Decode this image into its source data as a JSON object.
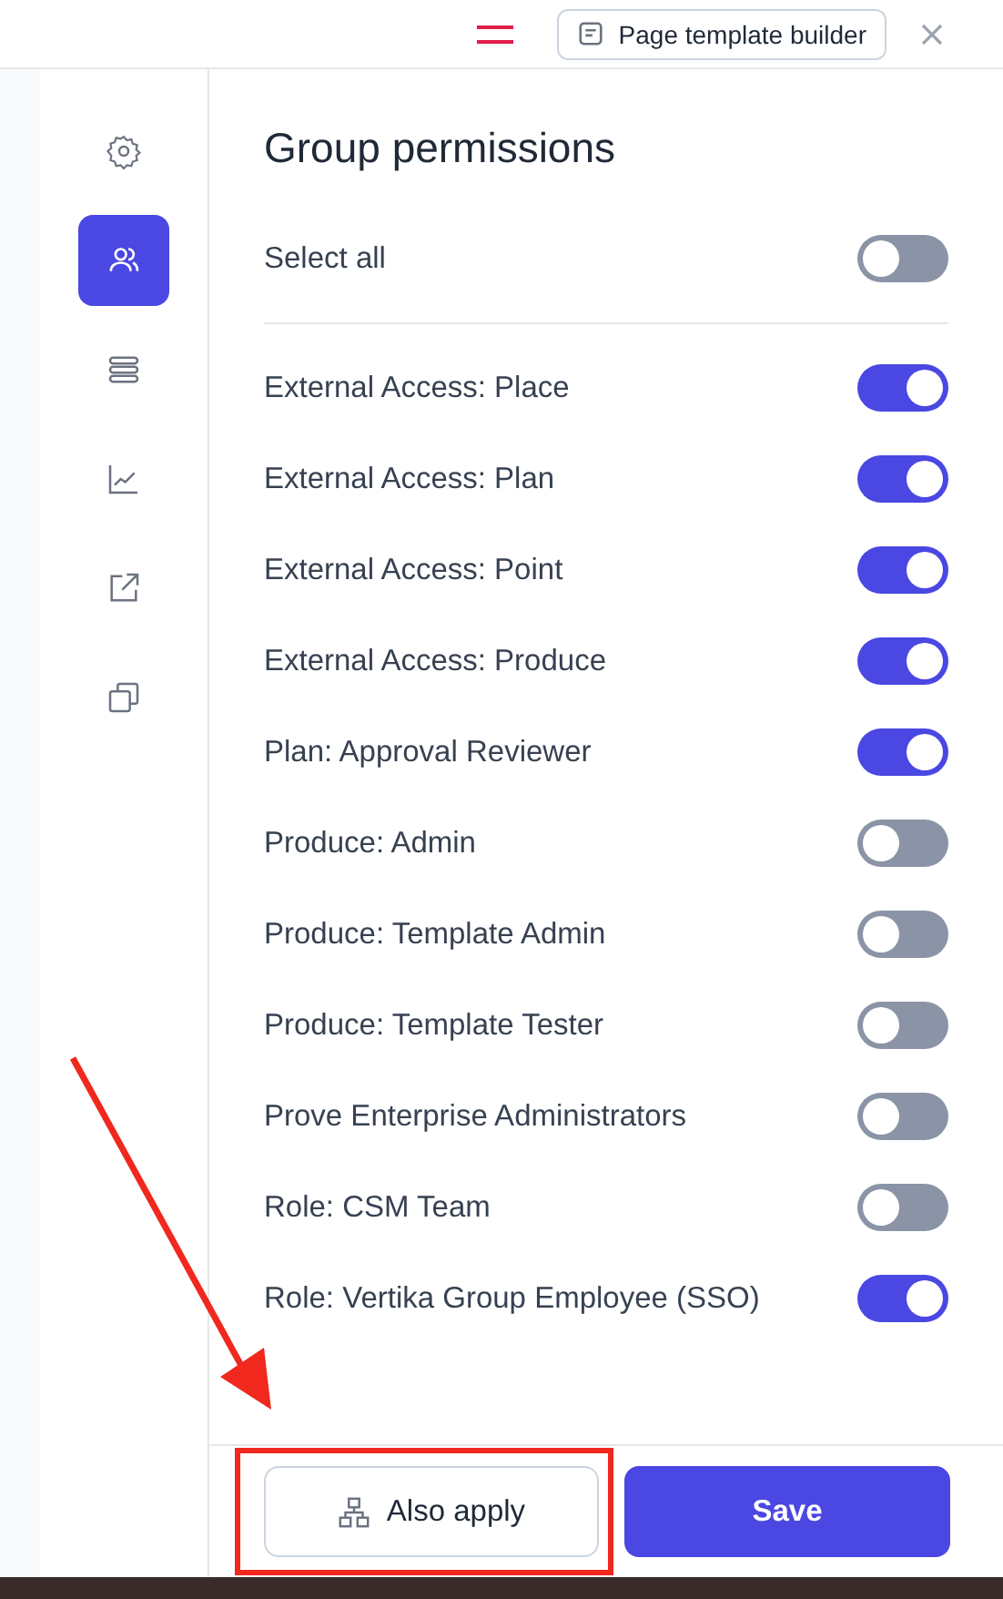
{
  "header": {
    "button": "Page template builder"
  },
  "sidebar": {
    "items": [
      {
        "selected": false
      },
      {
        "selected": true
      },
      {
        "selected": false
      },
      {
        "selected": false
      },
      {
        "selected": false
      },
      {
        "selected": false
      }
    ]
  },
  "panel": {
    "title": "Group permissions",
    "select_all": {
      "label": "Select all",
      "on": false
    },
    "permissions": [
      {
        "label": "External Access: Place",
        "on": true
      },
      {
        "label": "External Access: Plan",
        "on": true
      },
      {
        "label": "External Access: Point",
        "on": true
      },
      {
        "label": "External Access: Produce",
        "on": true
      },
      {
        "label": "Plan: Approval Reviewer",
        "on": true
      },
      {
        "label": "Produce: Admin",
        "on": false
      },
      {
        "label": "Produce: Template Admin",
        "on": false
      },
      {
        "label": "Produce: Template Tester",
        "on": false
      },
      {
        "label": "Prove Enterprise Administrators",
        "on": false
      },
      {
        "label": "Role: CSM Team",
        "on": false
      },
      {
        "label": "Role: Vertika Group Employee (SSO)",
        "on": true
      }
    ]
  },
  "footer": {
    "also_apply": "Also apply",
    "save": "Save"
  }
}
